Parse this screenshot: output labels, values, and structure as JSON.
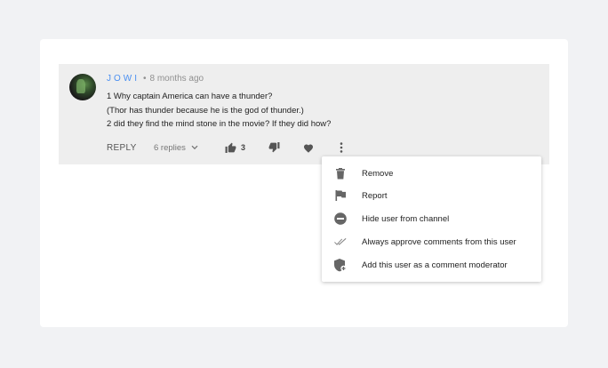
{
  "comment": {
    "author": "JOWI",
    "separator": "•",
    "timestamp": "8 months ago",
    "lines": [
      "1 Why captain America can have a thunder?",
      "(Thor has thunder because he is the god of thunder.)",
      "2 did they find the mind stone in the movie? If they did how?"
    ],
    "reply_label": "REPLY",
    "replies_label": "6 replies",
    "like_count": "3"
  },
  "menu": {
    "items": [
      {
        "label": "Remove",
        "icon": "trash-icon"
      },
      {
        "label": "Report",
        "icon": "flag-icon"
      },
      {
        "label": "Hide user from channel",
        "icon": "block-icon"
      },
      {
        "label": "Always approve comments from this user",
        "icon": "double-check-icon"
      },
      {
        "label": "Add this user as a comment moderator",
        "icon": "shield-add-icon"
      }
    ]
  }
}
